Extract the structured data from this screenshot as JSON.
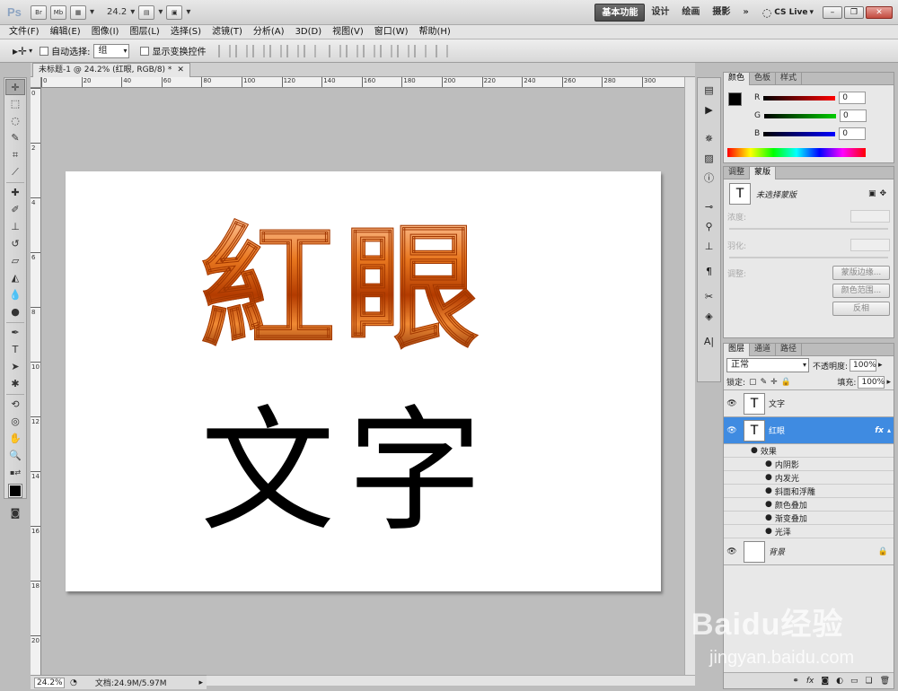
{
  "titlebar": {
    "logo": "Ps",
    "btn_br": "Br",
    "btn_mb": "Mb",
    "zoom_value": "24.2",
    "workspaces": [
      "基本功能",
      "设计",
      "绘画",
      "摄影"
    ],
    "more": "»",
    "cslive": "CS Live",
    "minimize": "–",
    "restore": "❐",
    "close": "✕"
  },
  "menu": [
    "文件(F)",
    "编辑(E)",
    "图像(I)",
    "图层(L)",
    "选择(S)",
    "滤镜(T)",
    "分析(A)",
    "3D(D)",
    "视图(V)",
    "窗口(W)",
    "帮助(H)"
  ],
  "options": {
    "auto_select_label": "自动选择:",
    "auto_select_value": "组",
    "show_transform_label": "显示变换控件"
  },
  "document": {
    "tab_title": "未标题-1 @ 24.2% (红眼, RGB/8) *",
    "tab_close": "✕",
    "ruler_h": [
      "0",
      "20",
      "40",
      "60",
      "80",
      "100",
      "120",
      "140",
      "160",
      "180",
      "200",
      "220",
      "240",
      "260",
      "280",
      "300"
    ],
    "ruler_v": [
      "0",
      "2",
      "4",
      "6",
      "8",
      "10",
      "12",
      "14",
      "16",
      "18",
      "20"
    ],
    "art_top": "紅眼",
    "art_bottom": "文字",
    "zoom": "24.2%",
    "doc_info": "文档:24.9M/5.97M"
  },
  "color_panel": {
    "tabs": [
      "颜色",
      "色板",
      "样式"
    ],
    "r_label": "R",
    "r_value": "0",
    "g_label": "G",
    "g_value": "0",
    "b_label": "B",
    "b_value": "0"
  },
  "adjust_panel": {
    "tabs": [
      "调整",
      "蒙版"
    ],
    "no_mask": "未选择蒙版",
    "density": "浓度:",
    "feather": "羽化:",
    "refine": "调整:",
    "btn_mask_edge": "蒙版边缘...",
    "btn_color_range": "颜色范围...",
    "btn_invert": "反相"
  },
  "layers_panel": {
    "tabs": [
      "图层",
      "通道",
      "路径"
    ],
    "blend_mode": "正常",
    "opacity_label": "不透明度:",
    "opacity_value": "100%",
    "lock_label": "锁定:",
    "fill_label": "填充:",
    "fill_value": "100%",
    "layers": [
      {
        "name": "文字",
        "thumb": "T"
      },
      {
        "name": "红眼",
        "thumb": "T",
        "fx": "fx"
      },
      {
        "name": "背景",
        "thumb": ""
      }
    ],
    "effects_label": "效果",
    "effects": [
      "内阴影",
      "内发光",
      "斜面和浮雕",
      "颜色叠加",
      "渐变叠加",
      "光泽"
    ]
  },
  "watermark": "Baidu经验",
  "watermark_url": "jingyan.baidu.com",
  "colors": {
    "selected_layer": "#3f8be1",
    "workspace_active": "#4a4a4a",
    "art_orange": "#e8771f"
  }
}
